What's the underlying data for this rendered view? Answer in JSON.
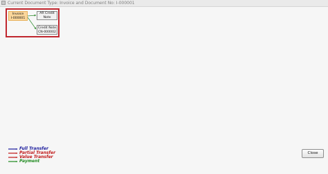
{
  "window": {
    "title": "Current Document Type: Invoice and Document No: I-000001"
  },
  "flow": {
    "nodes": {
      "invoice": {
        "line1": "Invoice",
        "line2": "I-000001"
      },
      "ar_credit_note": {
        "line1": "AR Credit",
        "line2": "Note"
      },
      "credit_note": {
        "line1": "Credit Note",
        "line2": "CN-000002"
      }
    }
  },
  "legend": {
    "items": [
      {
        "label": "Full Transfer",
        "color": "#1a1a9c"
      },
      {
        "label": "Partial Transfer",
        "color": "#c01818"
      },
      {
        "label": "Value Transfer",
        "color": "#c01818"
      },
      {
        "label": "Payment",
        "color": "#1f8a1f"
      }
    ]
  },
  "buttons": {
    "close_label": "Close"
  },
  "colors": {
    "frame_border": "#c0262e",
    "invoice_fill": "#fbd79b",
    "connector": "#2e8b2e"
  }
}
